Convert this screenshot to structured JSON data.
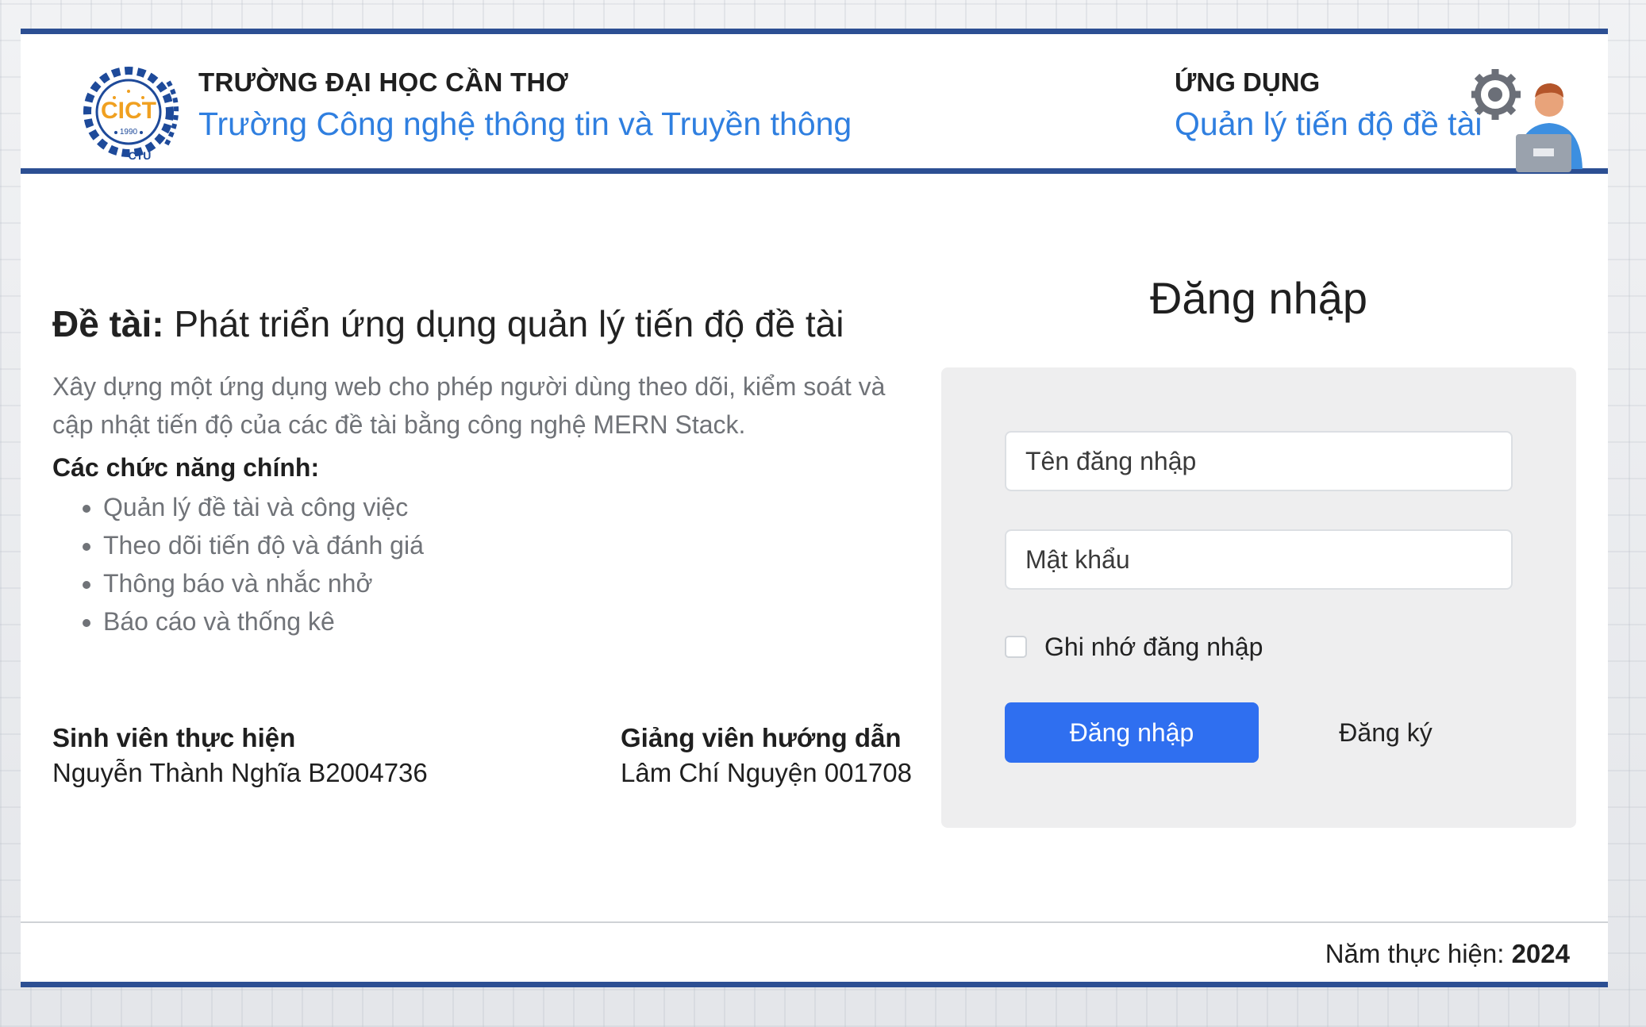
{
  "header": {
    "university_name": "TRƯỜNG ĐẠI HỌC CẦN THƠ",
    "school_name": "Trường Công nghệ thông tin và Truyền thông",
    "logo": {
      "icon": "cict-logo",
      "text": "CICT",
      "year": "1990",
      "sub": "CTU"
    },
    "app_label": "ỨNG DỤNG",
    "app_name": "Quản lý tiến độ đề tài",
    "app_icon": "user-laptop-gear-icon"
  },
  "project": {
    "topic_label": "Đề tài:",
    "topic_title": "Phát triển ứng dụng quản lý tiến độ đề tài",
    "description": "Xây dựng một ứng dụng web cho phép người dùng theo dõi, kiểm soát và cập nhật tiến độ của các đề tài bằng công nghệ MERN Stack.",
    "features_title": "Các chức năng chính:",
    "features": [
      "Quản lý đề tài và công việc",
      "Theo dõi tiến độ và đánh giá",
      "Thông báo và nhắc nhở",
      "Báo cáo và thống kê"
    ],
    "student_title": "Sinh viên thực hiện",
    "student_name": "Nguyễn Thành Nghĩa B2004736",
    "advisor_title": "Giảng viên hướng dẫn",
    "advisor_name": "Lâm Chí Nguyện 001708"
  },
  "login": {
    "title": "Đăng nhập",
    "username_placeholder": "Tên đăng nhập",
    "password_placeholder": "Mật khẩu",
    "remember_label": "Ghi nhớ đăng nhập",
    "remember_checked": false,
    "submit_label": "Đăng nhập",
    "register_label": "Đăng ký"
  },
  "footer": {
    "year_label": "Năm thực hiện:",
    "year_value": "2024"
  },
  "colors": {
    "brand_navy": "#2c4f93",
    "link_blue": "#2f7fe0",
    "button_blue": "#2f6ff0",
    "logo_orange": "#f0a020"
  }
}
